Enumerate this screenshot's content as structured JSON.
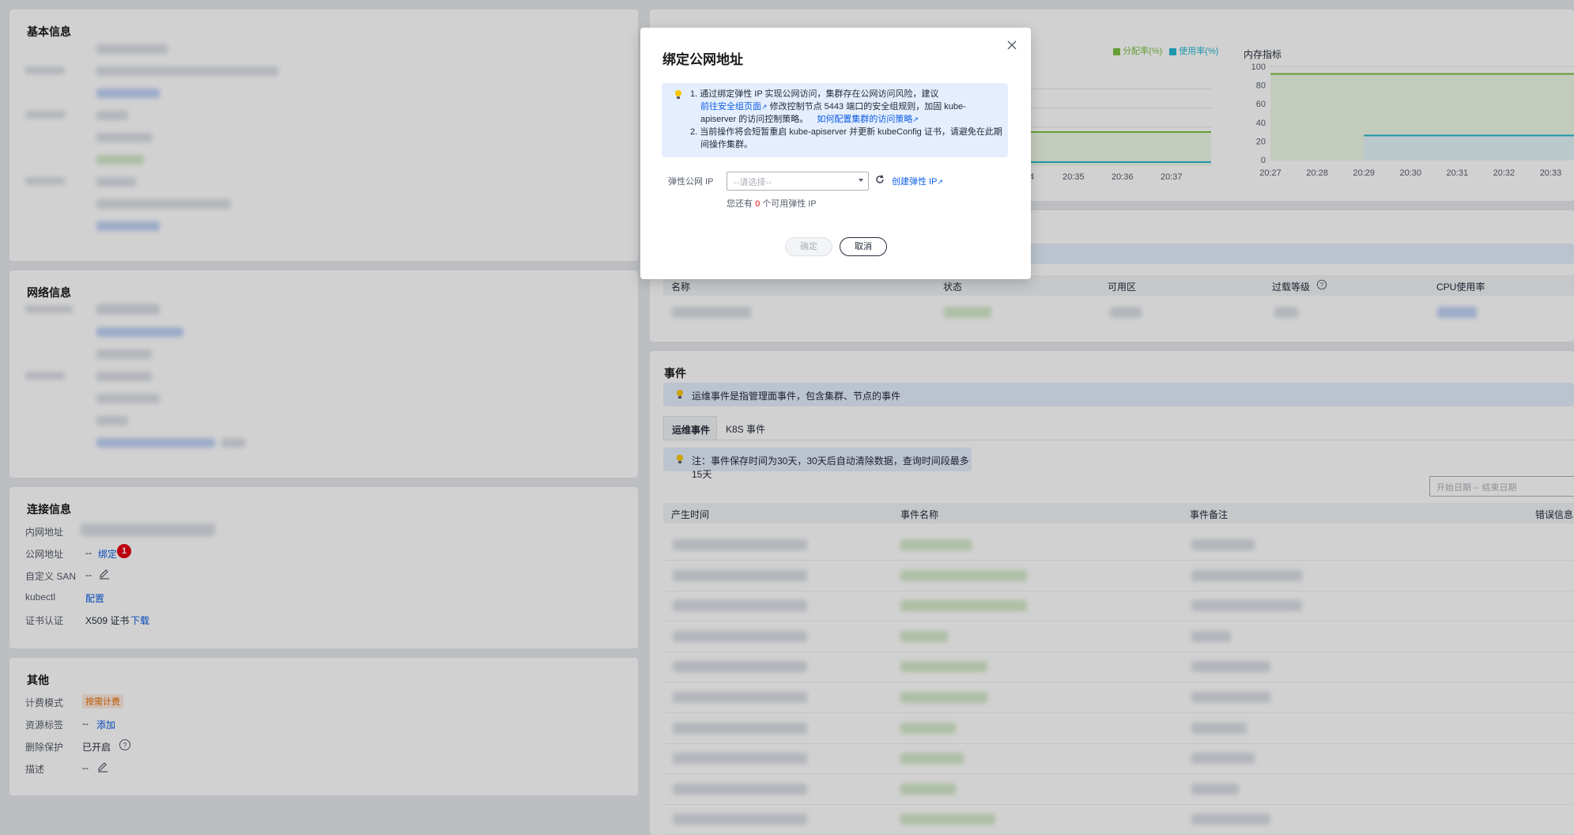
{
  "basic_info": {
    "title": "基本信息"
  },
  "network_info": {
    "title": "网络信息"
  },
  "connection": {
    "title": "连接信息",
    "rows": [
      {
        "label": "内网地址",
        "value": ""
      },
      {
        "label": "公网地址",
        "value": "--",
        "link": "绑定",
        "badge": "1"
      },
      {
        "label": "自定义 SAN",
        "value": "--"
      },
      {
        "label": "kubectl",
        "link": "配置"
      },
      {
        "label": "证书认证",
        "value": "X509 证书",
        "link": "下载"
      }
    ]
  },
  "other": {
    "title": "其他",
    "rows": [
      {
        "label": "计费模式",
        "tag": "按需计费"
      },
      {
        "label": "资源标签",
        "value": "--",
        "link": "添加"
      },
      {
        "label": "删除保护",
        "value": "已开启"
      },
      {
        "label": "描述",
        "value": "--"
      }
    ]
  },
  "monitor": {
    "legend": [
      {
        "label": "分配率(%)",
        "color": "#7cc140"
      },
      {
        "label": "使用率(%)",
        "color": "#26b7d2"
      }
    ],
    "left_x_ticks": [
      "4",
      "20:35",
      "20:36",
      "20:37"
    ],
    "memory_title": "内存指标",
    "memory_y_ticks": [
      "100",
      "80",
      "60",
      "40",
      "20",
      "0"
    ],
    "memory_x_ticks": [
      "20:27",
      "20:28",
      "20:29",
      "20:30",
      "20:31",
      "20:32",
      "20:33"
    ]
  },
  "chart_data": [
    {
      "type": "line",
      "title": "内存指标",
      "x": [
        "20:27",
        "20:28",
        "20:29",
        "20:30",
        "20:31",
        "20:32",
        "20:33"
      ],
      "ylim": [
        0,
        100
      ],
      "series": [
        {
          "name": "分配率(%)",
          "values": [
            92,
            92,
            92,
            92,
            92,
            92,
            92
          ]
        },
        {
          "name": "使用率(%)",
          "values": [
            null,
            null,
            26,
            26,
            26,
            26,
            26
          ]
        }
      ]
    }
  ],
  "nodes_table": {
    "headers": [
      "名称",
      "状态",
      "可用区",
      "过载等级",
      "CPU使用率"
    ]
  },
  "events": {
    "title": "事件",
    "info": "运维事件是指管理面事件，包含集群、节点的事件",
    "tabs": [
      "运维事件",
      "K8S 事件"
    ],
    "note": "注：事件保存时间为30天，30天后自动清除数据，查询时间段最多15天",
    "date_placeholder": "开始日期 -- 结束日期",
    "headers": [
      "产生时间",
      "事件名称",
      "事件备注",
      "错误信息"
    ]
  },
  "modal": {
    "title": "绑定公网地址",
    "tip": {
      "line1": "1. 通过绑定弹性 IP 实现公网访问，集群存在公网访问风险，建议",
      "link1": "前往安全组页面",
      "line1b": "修改控制节点 5443 端口的安全组规则，加固 kube-",
      "line1c": "apiserver 的访问控制策略。",
      "link2": "如何配置集群的访问策略",
      "line2": "2. 当前操作将会短暂重启 kube-apiserver 并更新 kubeConfig 证书，请避免在此期",
      "line2b": "间操作集群。"
    },
    "field_label": "弹性公网 IP",
    "select_placeholder": "--请选择--",
    "create_link": "创建弹性 IP",
    "hint_prefix": "您还有 ",
    "hint_count": "0",
    "hint_suffix": " 个可用弹性 IP",
    "confirm": "确定",
    "cancel": "取消"
  }
}
